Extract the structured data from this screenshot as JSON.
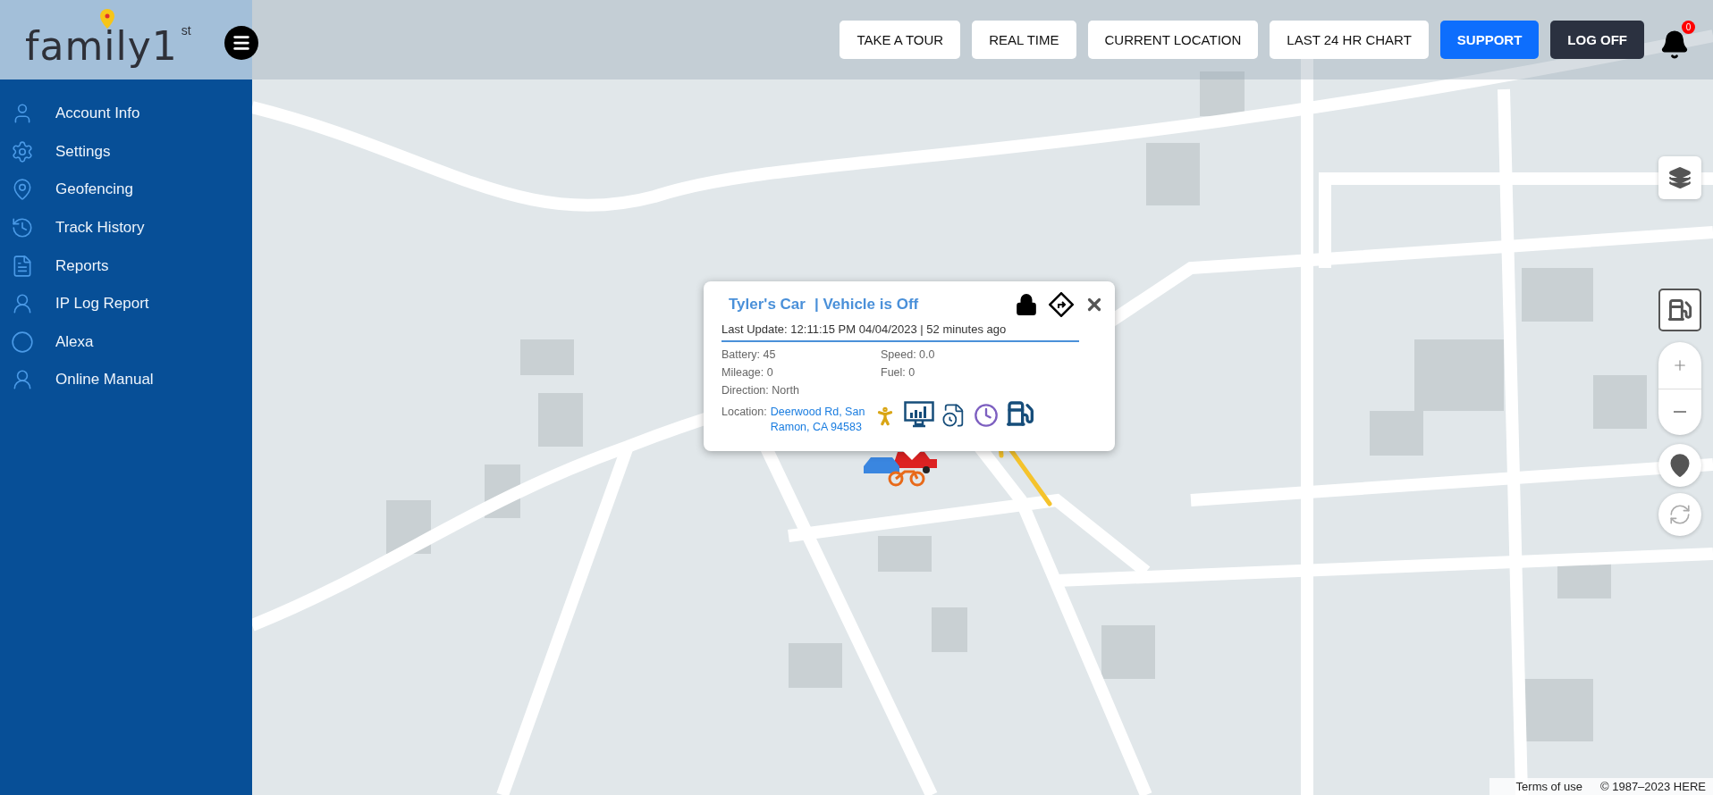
{
  "logo": {
    "name": "family1",
    "suffix": "st"
  },
  "sidebar": {
    "items": [
      {
        "label": "Account Info"
      },
      {
        "label": "Settings"
      },
      {
        "label": "Geofencing"
      },
      {
        "label": "Track History"
      },
      {
        "label": "Reports"
      },
      {
        "label": "IP Log Report"
      },
      {
        "label": "Alexa"
      },
      {
        "label": "Online Manual"
      }
    ]
  },
  "toolbar": {
    "buttons": [
      {
        "label": "TAKE A TOUR",
        "kind": "plain"
      },
      {
        "label": "REAL TIME",
        "kind": "plain"
      },
      {
        "label": "CURRENT LOCATION",
        "kind": "plain"
      },
      {
        "label": "LAST 24 HR CHART",
        "kind": "plain"
      },
      {
        "label": "SUPPORT",
        "kind": "primary"
      },
      {
        "label": "LOG OFF",
        "kind": "dark"
      }
    ],
    "notifications": {
      "count": "0"
    }
  },
  "popup": {
    "title": "Tyler's Car",
    "status": "| Vehicle is Off",
    "last_update": "Last Update: 12:11:15 PM 04/04/2023 | 52 minutes ago",
    "details_left": [
      "Battery: 45",
      "Mileage: 0",
      "Direction: North"
    ],
    "details_right": [
      "Speed: 0.0",
      "Fuel: 0"
    ],
    "location": {
      "label": "Location:",
      "value": "Deerwood Rd, San Ramon, CA 94583"
    }
  },
  "map_footer": {
    "terms": "Terms of use",
    "copyright": "© 1987–2023 HERE"
  }
}
